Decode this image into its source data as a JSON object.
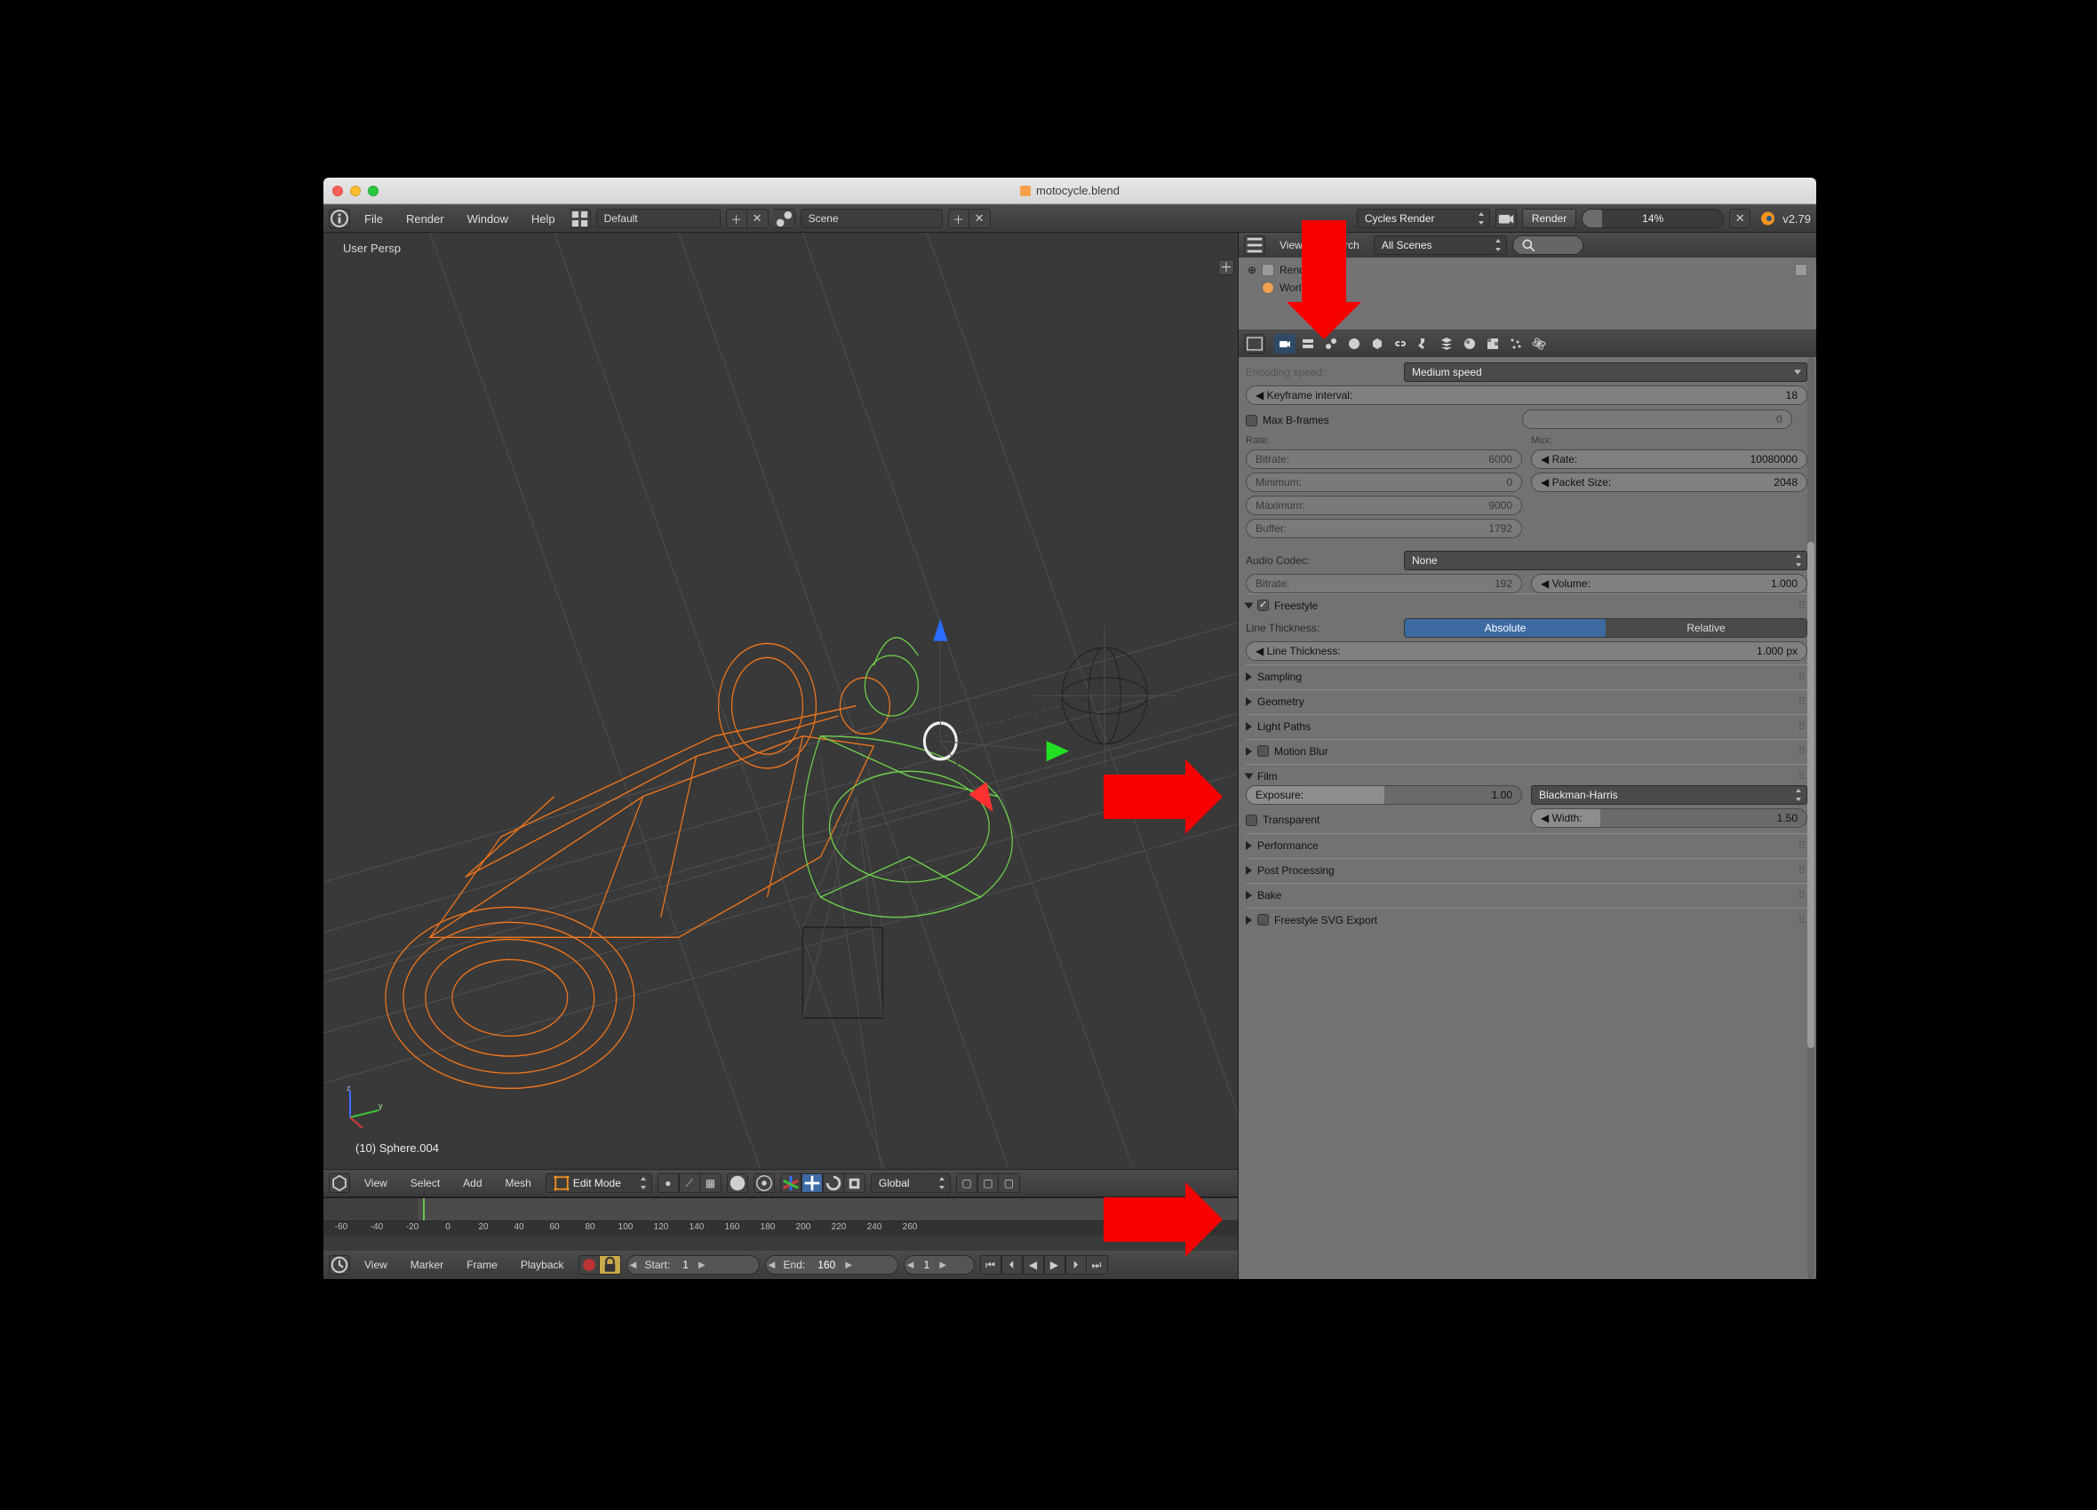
{
  "titlebar": {
    "filename": "motocycle.blend"
  },
  "info": {
    "menus": [
      "File",
      "Render",
      "Window",
      "Help"
    ],
    "layout": "Default",
    "scene": "Scene",
    "engine": "Cycles Render",
    "render_btn": "Render",
    "progress_pct": 14,
    "progress_label": "14%",
    "version": "v2.79"
  },
  "viewport": {
    "persp": "User Persp",
    "selection": "(10) Sphere.004",
    "header": {
      "menus": [
        "View",
        "Select",
        "Add",
        "Mesh"
      ],
      "mode": "Edit Mode",
      "orientation": "Global"
    }
  },
  "timeline": {
    "ticks": [
      "-60",
      "-40",
      "-20",
      "0",
      "20",
      "40",
      "60",
      "80",
      "100",
      "120",
      "140",
      "160",
      "180",
      "200",
      "220",
      "240",
      "260"
    ],
    "menus": [
      "View",
      "Marker",
      "Frame",
      "Playback"
    ],
    "start_label": "Start:",
    "start_val": "1",
    "end_label": "End:",
    "end_val": "160",
    "frame_val": "1"
  },
  "outliner": {
    "search_lbl": "Search",
    "scene_filter": "All Scenes",
    "rows": [
      "RenderLayers",
      "World"
    ]
  },
  "props": {
    "encoding_speed_lbl": "Encoding speed:",
    "encoding_speed_val": "Medium speed",
    "keyframe_lbl": "Keyframe interval:",
    "keyframe_val": "18",
    "maxb_label": "Max B-frames",
    "maxb_val": "0",
    "rate_h": "Rate:",
    "mux_h": "Mux:",
    "rate_bitrate_lbl": "Bitrate:",
    "rate_bitrate_val": "6000",
    "rate_min_lbl": "Minimum:",
    "rate_min_val": "0",
    "rate_max_lbl": "Maximum:",
    "rate_max_val": "9000",
    "rate_buf_lbl": "Buffer:",
    "rate_buf_val": "1792",
    "mux_rate_lbl": "Rate:",
    "mux_rate_val": "10080000",
    "mux_pkt_lbl": "Packet Size:",
    "mux_pkt_val": "2048",
    "audio_codec_lbl": "Audio Codec:",
    "audio_codec_val": "None",
    "audio_bitrate_lbl": "Bitrate:",
    "audio_bitrate_val": "192",
    "audio_vol_lbl": "Volume:",
    "audio_vol_val": "1.000",
    "freestyle_title": "Freestyle",
    "lt_label": "Line Thickness:",
    "lt_abs": "Absolute",
    "lt_rel": "Relative",
    "lt_val_lbl": "Line Thickness:",
    "lt_val": "1.000 px",
    "p_sampling": "Sampling",
    "p_geometry": "Geometry",
    "p_lightpaths": "Light Paths",
    "p_motionblur": "Motion Blur",
    "p_film": "Film",
    "film_exp_lbl": "Exposure:",
    "film_exp_val": "1.00",
    "film_filter": "Blackman-Harris",
    "film_width_lbl": "Width:",
    "film_width_val": "1.50",
    "film_transparent": "Transparent",
    "p_perf": "Performance",
    "p_post": "Post Processing",
    "p_bake": "Bake",
    "p_svg": "Freestyle SVG Export"
  }
}
